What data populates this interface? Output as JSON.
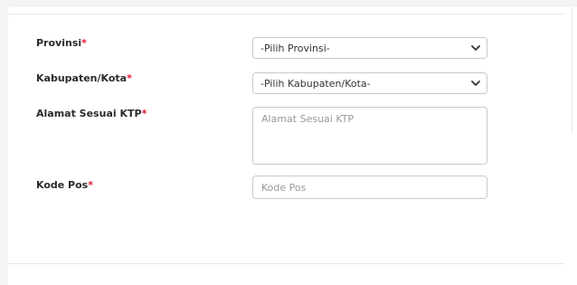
{
  "form": {
    "required_mark": "*",
    "provinsi": {
      "label": "Provinsi",
      "selected": "-Pilih Provinsi-"
    },
    "kabupaten": {
      "label": "Kabupaten/Kota",
      "selected": "-Pilih Kabupaten/Kota-"
    },
    "alamat": {
      "label": "Alamat Sesuai KTP",
      "placeholder": "Alamat Sesuai KTP"
    },
    "kode_pos": {
      "label": "Kode Pos",
      "placeholder": "Kode Pos"
    }
  },
  "icons": {
    "dropdown": "chevron-down-icon"
  },
  "colors": {
    "required": "#e4142c",
    "border": "#c9c9c9",
    "label": "#2b2b2b",
    "placeholder": "#9a9a9a"
  }
}
